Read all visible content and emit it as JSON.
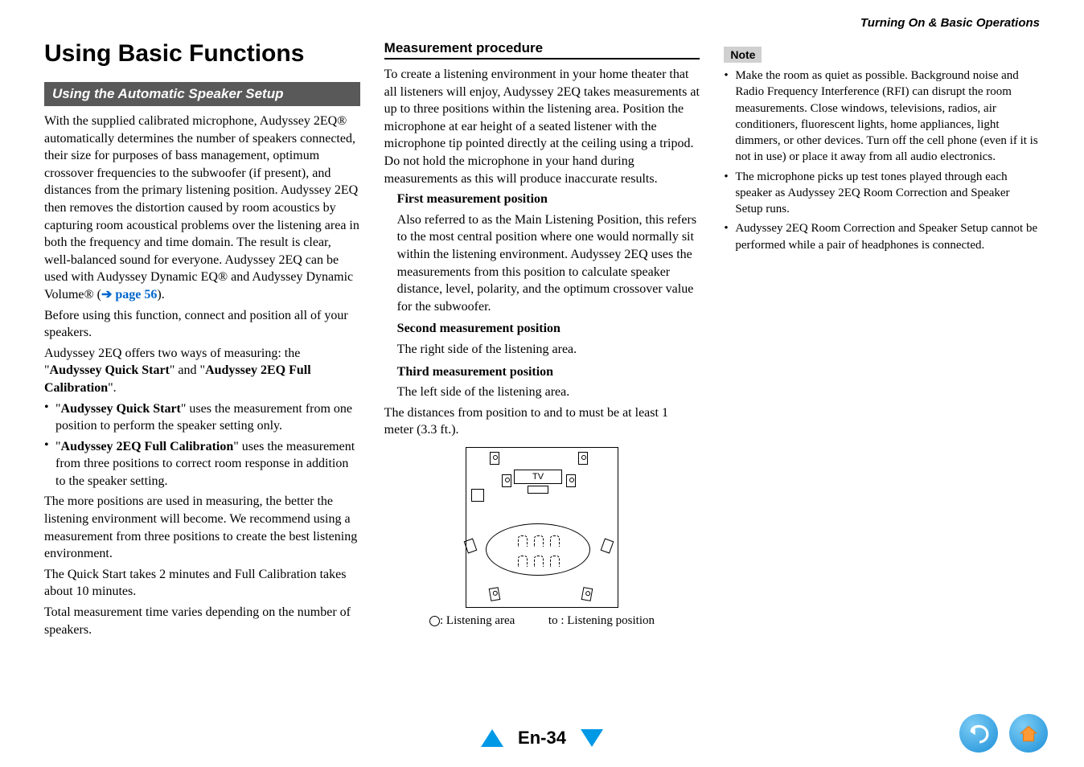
{
  "breadcrumb": "Turning On & Basic Operations",
  "page_title": "Using Basic Functions",
  "section_bar": "Using the Automatic Speaker Setup",
  "col1": {
    "p1": "With the supplied calibrated microphone, Audyssey 2EQ® automatically determines the number of speakers connected, their size for purposes of bass management, optimum crossover frequencies to the subwoofer (if present), and distances from the primary listening position. Audyssey 2EQ then removes the distortion caused by room acoustics by capturing room acoustical problems over the listening area in both the frequency and time domain. The result is clear, well-balanced sound for everyone. Audyssey 2EQ can be used with Audyssey Dynamic EQ® and Audyssey Dynamic Volume® (",
    "p1_link_arrow": "➔ ",
    "p1_link": "page 56",
    "p1_after": ").",
    "p2": "Before using this function, connect and position all of your speakers.",
    "p3a": "Audyssey 2EQ offers two ways of measuring: the \"",
    "p3b": "Audyssey Quick Start",
    "p3c": "\" and \"",
    "p3d": "Audyssey 2EQ Full Calibration",
    "p3e": "\".",
    "b1_pre": "\"",
    "b1_bold": "Audyssey Quick Start",
    "b1_rest": "\" uses the measurement from one position to perform the speaker setting only.",
    "b2_pre": "\"",
    "b2_bold": "Audyssey 2EQ Full Calibration",
    "b2_rest": "\" uses the measurement from three positions to correct room response in addition to the speaker setting.",
    "p4": "The more positions are used in measuring, the better the listening environment will become. We recommend using a measurement from three positions to create the best listening environment.",
    "p5": "The Quick Start takes 2 minutes and Full Calibration takes about 10 minutes.",
    "p6": "Total measurement time varies depending on the number of speakers."
  },
  "col2": {
    "subhead": "Measurement procedure",
    "intro": "To create a listening environment in your home theater that all listeners will enjoy, Audyssey 2EQ takes measurements at up to three positions within the listening area. Position the microphone at ear height of a seated listener with the microphone tip pointed directly at the ceiling using a tripod. Do not hold the microphone in your hand during measurements as this will produce inaccurate results.",
    "pos1_title": "First measurement position",
    "pos1_body": "Also referred to as the Main Listening Position, this refers to the most central position where one would normally sit within the listening environment. Audyssey 2EQ uses the measurements from this position to calculate speaker distance, level, polarity, and the optimum crossover value for the subwoofer.",
    "pos2_title": "Second measurement position",
    "pos2_body": "The right side of the listening area.",
    "pos3_title": "Third measurement position",
    "pos3_body": "The left side of the listening area.",
    "dist": "The distances from position      to       and      to       must be at least 1 meter (3.3 ft.).",
    "tv_label": "TV",
    "legend_area": ": Listening area",
    "legend_pos": "to      : Listening position"
  },
  "col3": {
    "note_label": "Note",
    "n1": "Make the room as quiet as possible. Background noise and Radio Frequency Interference (RFI) can disrupt the room measurements. Close windows, televisions, radios, air conditioners, fluorescent lights, home appliances, light dimmers, or other devices. Turn off the cell phone (even if it is not in use) or place it away from all audio electronics.",
    "n2": "The microphone picks up test tones played through each speaker as Audyssey 2EQ Room Correction and Speaker Setup runs.",
    "n3": "Audyssey 2EQ Room Correction and Speaker Setup cannot be performed while a pair of headphones is connected."
  },
  "page_number": "En-34"
}
